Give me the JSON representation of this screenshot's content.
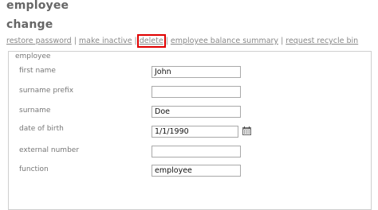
{
  "header": {
    "title": "employee",
    "subtitle": "change"
  },
  "actions": [
    {
      "label": "restore password",
      "highlighted": false
    },
    {
      "label": "make inactive",
      "highlighted": false
    },
    {
      "label": "delete",
      "highlighted": true
    },
    {
      "label": "employee balance summary",
      "highlighted": false
    },
    {
      "label": "request recycle bin",
      "highlighted": false
    }
  ],
  "form": {
    "legend": "employee",
    "fields": [
      {
        "label": "first name",
        "value": "John"
      },
      {
        "label": "surname prefix",
        "value": ""
      },
      {
        "label": "surname",
        "value": "Doe"
      },
      {
        "label": "date of birth",
        "value": "1/1/1990",
        "icon": "calendar-icon"
      },
      {
        "label": "external number",
        "value": ""
      },
      {
        "label": "function",
        "value": "employee"
      }
    ]
  },
  "colors": {
    "highlight": "#e00000",
    "link": "#888888"
  }
}
